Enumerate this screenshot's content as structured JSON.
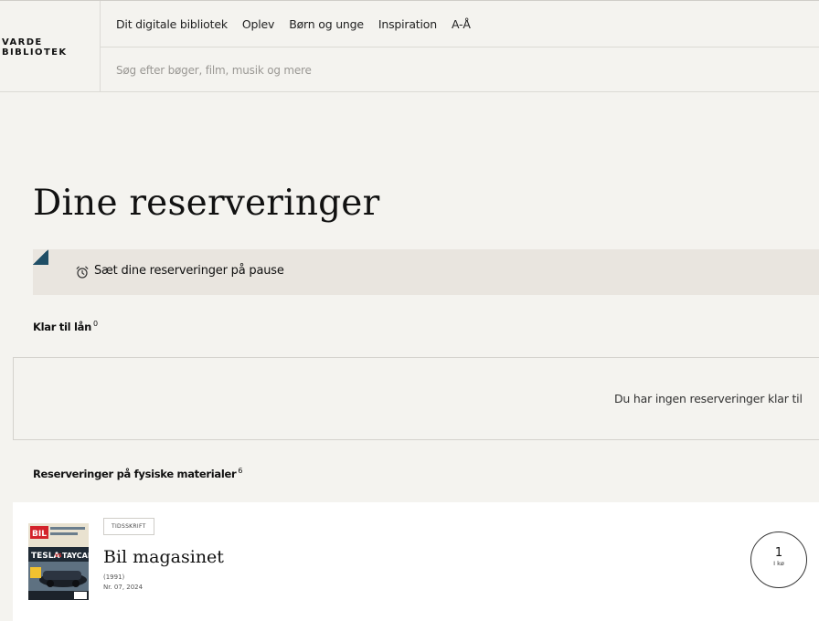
{
  "header": {
    "logo_line1": "VARDE",
    "logo_line2": "BIBLIOTEK",
    "nav": [
      {
        "label": "Dit digitale bibliotek"
      },
      {
        "label": "Oplev"
      },
      {
        "label": "Børn og unge"
      },
      {
        "label": "Inspiration"
      },
      {
        "label": "A-Å"
      }
    ],
    "search_placeholder": "Søg efter bøger, film, musik og mere"
  },
  "page": {
    "title": "Dine reserveringer",
    "pause_label": "Sæt dine reserveringer på pause",
    "pause_icon": "alarm-clock-icon"
  },
  "ready": {
    "title": "Klar til lån",
    "count": "0",
    "empty_message": "Du har ingen reserveringer klar til"
  },
  "physical": {
    "title": "Reserveringer på fysiske materialer",
    "count": "6",
    "items": [
      {
        "badge": "TIDSSKRIFT",
        "title": "Bil magasinet",
        "year": "(1991)",
        "issue": "Nr. 07, 2024",
        "queue_number": "1",
        "queue_label": "I kø",
        "cover_texts": {
          "brand": "BIL",
          "headline_left": "TESLA",
          "headline_vs": "VS",
          "headline_right": "TAYCAN"
        }
      }
    ]
  },
  "colors": {
    "background": "#f4f3ef",
    "pause_bar": "#e9e5df",
    "accent_corner": "#1f4e66",
    "card": "#ffffff"
  }
}
